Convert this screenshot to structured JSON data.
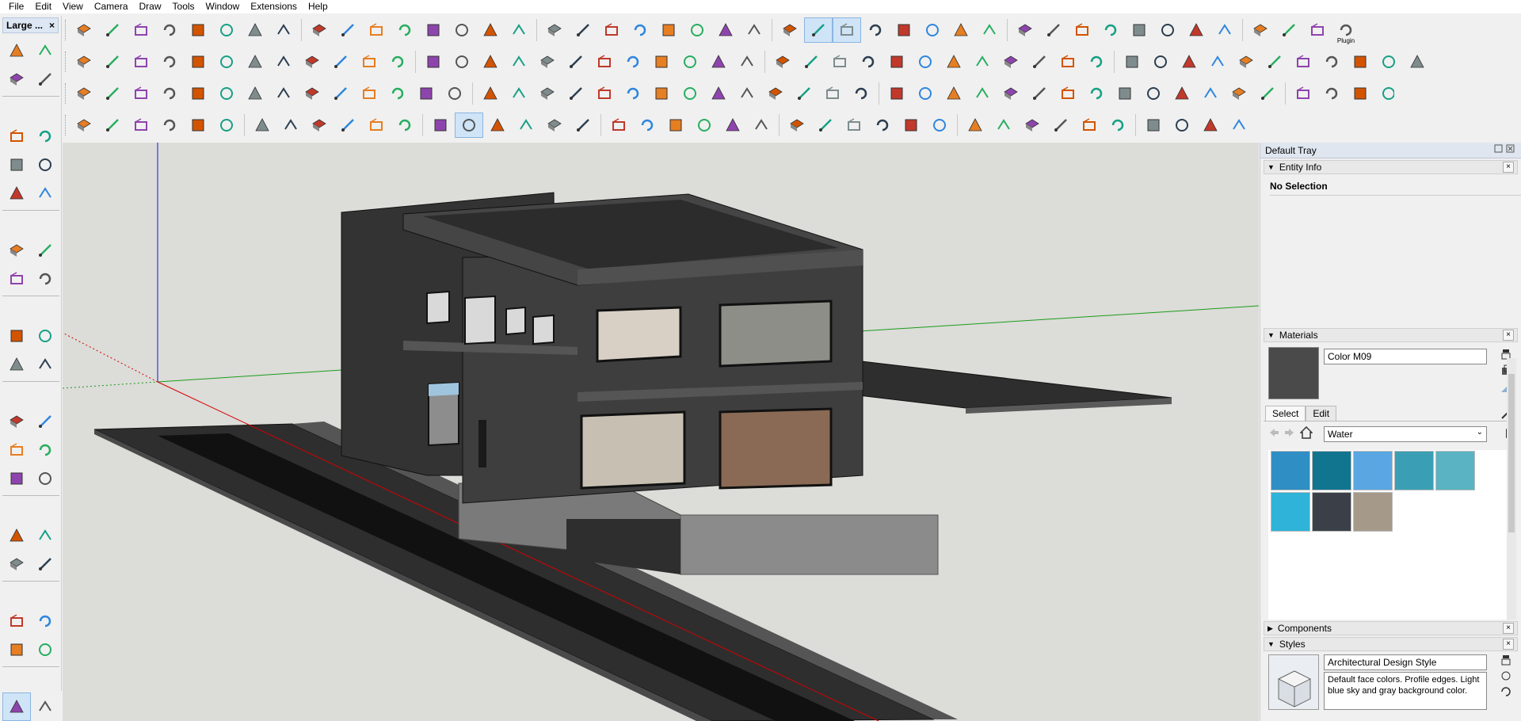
{
  "menu": [
    "File",
    "Edit",
    "View",
    "Camera",
    "Draw",
    "Tools",
    "Window",
    "Extensions",
    "Help"
  ],
  "left_toolbar": {
    "title": "Large ...",
    "close": "×"
  },
  "plugin_button_label": "Plugin",
  "tray": {
    "title": "Default Tray",
    "entity_info": {
      "header": "Entity Info",
      "selection": "No Selection"
    },
    "materials": {
      "header": "Materials",
      "current_name": "Color M09",
      "tabs": [
        "Select",
        "Edit"
      ],
      "library": "Water",
      "thumbnail_colors": [
        "#2f8fc4",
        "#117590",
        "#5aa6e2",
        "#3a9fb4",
        "#5ab3c2",
        "#2fb3d8",
        "#3b4048",
        "#a59a8a"
      ]
    },
    "components": {
      "header": "Components"
    },
    "styles": {
      "header": "Styles",
      "name": "Architectural Design Style",
      "description": "Default face colors. Profile edges. Light blue sky and gray background color."
    }
  },
  "colors": {
    "axis_red": "#d40000",
    "axis_green": "#1a9c1a",
    "axis_blue": "#1a1acc",
    "background": "#dcdcd9",
    "building": "#3a3a3a"
  },
  "icons": {
    "row1": [
      "zoom-icon",
      "select-icon",
      "eraser-icon",
      "pencil-icon",
      "arc-icon",
      "rectangle-icon",
      "push-pull-icon",
      "follow-me-icon",
      "move-icon",
      "rotate-icon",
      "scale-icon",
      "offset-icon",
      "tape-icon",
      "paint-icon",
      "orbit-icon",
      "hand-icon",
      "magnifier-icon",
      "zoom-extents-icon",
      "sandbox-icon",
      "layers-icon",
      "layers2-icon",
      "layers3-icon",
      "user-icon",
      "target-icon",
      "xray-icon",
      "backedges-icon",
      "wireframe-icon",
      "box-orange-icon",
      "box-blue-icon",
      "box-gray-icon",
      "section-icon",
      "section2-icon",
      "section3-icon",
      "plane-icon",
      "plane2-icon",
      "plane3-icon",
      "lamp-icon",
      "black-square-icon",
      "black-diamond-icon",
      "cone-icon",
      "black-cube-icon",
      "sphere-icon",
      "cloud-icon",
      "plugin-icon"
    ],
    "row2_count": 47,
    "row3_count": 50,
    "row4_count": 40,
    "left_count": 36
  }
}
